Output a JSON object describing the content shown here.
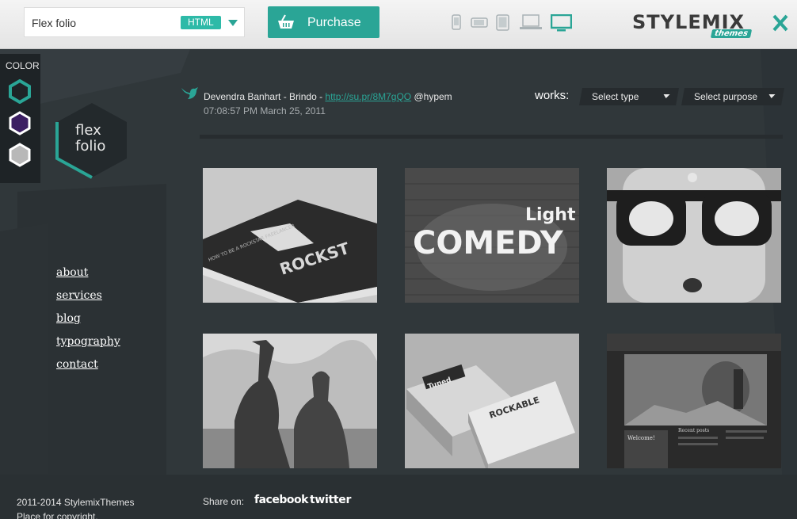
{
  "topbar": {
    "theme_name": "Flex folio",
    "badge": "HTML",
    "purchase_label": "Purchase",
    "devices": [
      "phone-icon",
      "phone-landscape-icon",
      "tablet-icon",
      "laptop-icon",
      "desktop-icon"
    ],
    "active_device": "desktop-icon",
    "brand": "STYLEMIX",
    "brand_sub": "themes",
    "accent": "#2aa596"
  },
  "color_panel": {
    "title": "COLOR",
    "swatches": [
      "#2aa596",
      "#3c1f63",
      "#b8b8b8"
    ]
  },
  "logo": {
    "line1": "flex",
    "line2": "folio"
  },
  "nav": {
    "items": [
      "about",
      "services",
      "blog",
      "typography",
      "contact"
    ]
  },
  "tweet": {
    "text": "Devendra Banhart - Brindo - ",
    "link": "http://su.pr/8M7gQO",
    "handle": " @hypem",
    "time": "07:08:57 PM March 25, 2011"
  },
  "filters": {
    "label": "works:",
    "type_placeholder": "Select type",
    "purpose_placeholder": "Select purpose"
  },
  "portfolio": {
    "items": [
      {
        "caption_a": "ROCKST",
        "caption_b": "HOW TO BE A ROCKSTAR FREELANCER"
      },
      {
        "caption_a": "COMEDY",
        "caption_b": "Light"
      },
      {
        "caption_a": "",
        "caption_b": ""
      },
      {
        "caption_a": "",
        "caption_b": ""
      },
      {
        "caption_a": "ROCKABLE",
        "caption_b": "Tuned"
      },
      {
        "caption_a": "Welcome!",
        "caption_b": "Recent posts"
      }
    ]
  },
  "footer": {
    "copyright": "2011-2014 StylemixThemes",
    "note": "Place for copyright.",
    "share_label": "Share on:",
    "facebook": "facebook",
    "twitter": "twitter"
  }
}
